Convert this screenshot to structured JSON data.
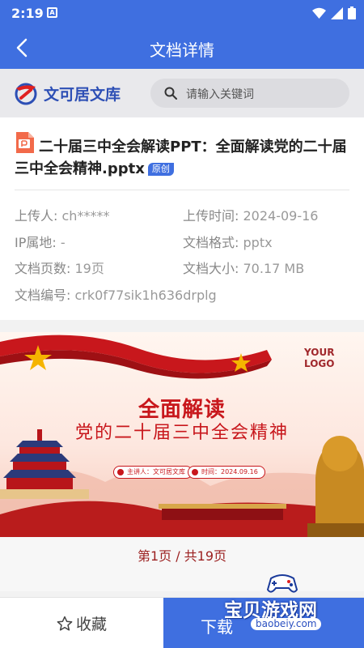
{
  "status_bar": {
    "time": "2:19",
    "notification_icon": "A"
  },
  "app_bar": {
    "title": "文档详情"
  },
  "brand": {
    "name": "文可居文库"
  },
  "search": {
    "placeholder": "请输入关键词"
  },
  "document": {
    "title": "二十届三中全会解读PPT：全面解读党的二十届三中全会精神.pptx",
    "badge": "原创",
    "meta": [
      {
        "label": "上传人:",
        "value": "ch*****"
      },
      {
        "label": "上传时间:",
        "value": "2024-09-16"
      },
      {
        "label": "IP属地:",
        "value": "-"
      },
      {
        "label": "文档格式:",
        "value": "pptx"
      },
      {
        "label": "文档页数:",
        "value": "19页"
      },
      {
        "label": "文档大小:",
        "value": "70.17 MB"
      },
      {
        "label": "文档编号:",
        "value": "crk0f77sik1h636drplg"
      }
    ]
  },
  "preview": {
    "logo_text": "YOUR LOGO",
    "heading1": "全面解读",
    "heading2": "党的二十届三中全会精神",
    "presenter": "主讲人：文可居文库",
    "date": "时间：2024.09.16",
    "pager": "第1页 / 共19页"
  },
  "bottom": {
    "favorite_label": "收藏",
    "download_label": "下载"
  },
  "watermark": {
    "cn": "宝贝游戏网",
    "en": "baobeiy.com"
  },
  "colors": {
    "primary": "#3f6fe0",
    "slide_red": "#c8171c"
  }
}
